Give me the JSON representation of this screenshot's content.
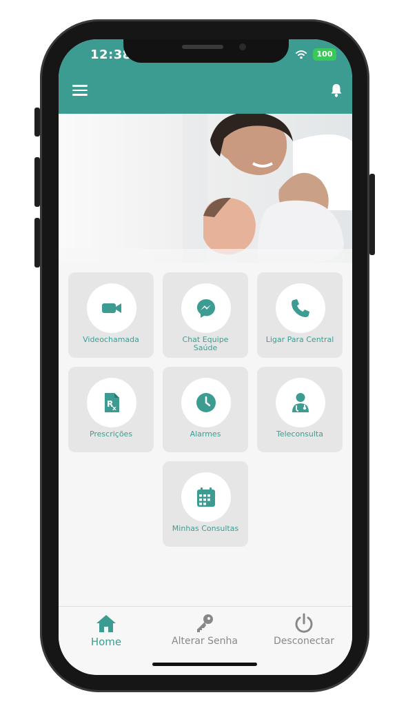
{
  "status_bar": {
    "time": "12:38",
    "battery": "100"
  },
  "tiles": [
    {
      "label": "Videochamada",
      "icon": "video-camera-icon"
    },
    {
      "label": "Chat Equipe Saúde",
      "icon": "messenger-chat-icon"
    },
    {
      "label": "Ligar Para Central",
      "icon": "phone-icon"
    },
    {
      "label": "Prescrições",
      "icon": "prescription-icon"
    },
    {
      "label": "Alarmes",
      "icon": "clock-icon"
    },
    {
      "label": "Teleconsulta",
      "icon": "doctor-icon"
    },
    {
      "label": "Minhas Consultas",
      "icon": "calendar-icon"
    }
  ],
  "bottom_nav": [
    {
      "label": "Home",
      "icon": "home-icon",
      "active": true
    },
    {
      "label": "Alterar Senha",
      "icon": "key-icon",
      "active": false
    },
    {
      "label": "Desconectar",
      "icon": "power-icon",
      "active": false
    }
  ],
  "colors": {
    "primary": "#3d9c92",
    "tile_bg": "#e6e6e6",
    "nav_inactive": "#888888"
  }
}
